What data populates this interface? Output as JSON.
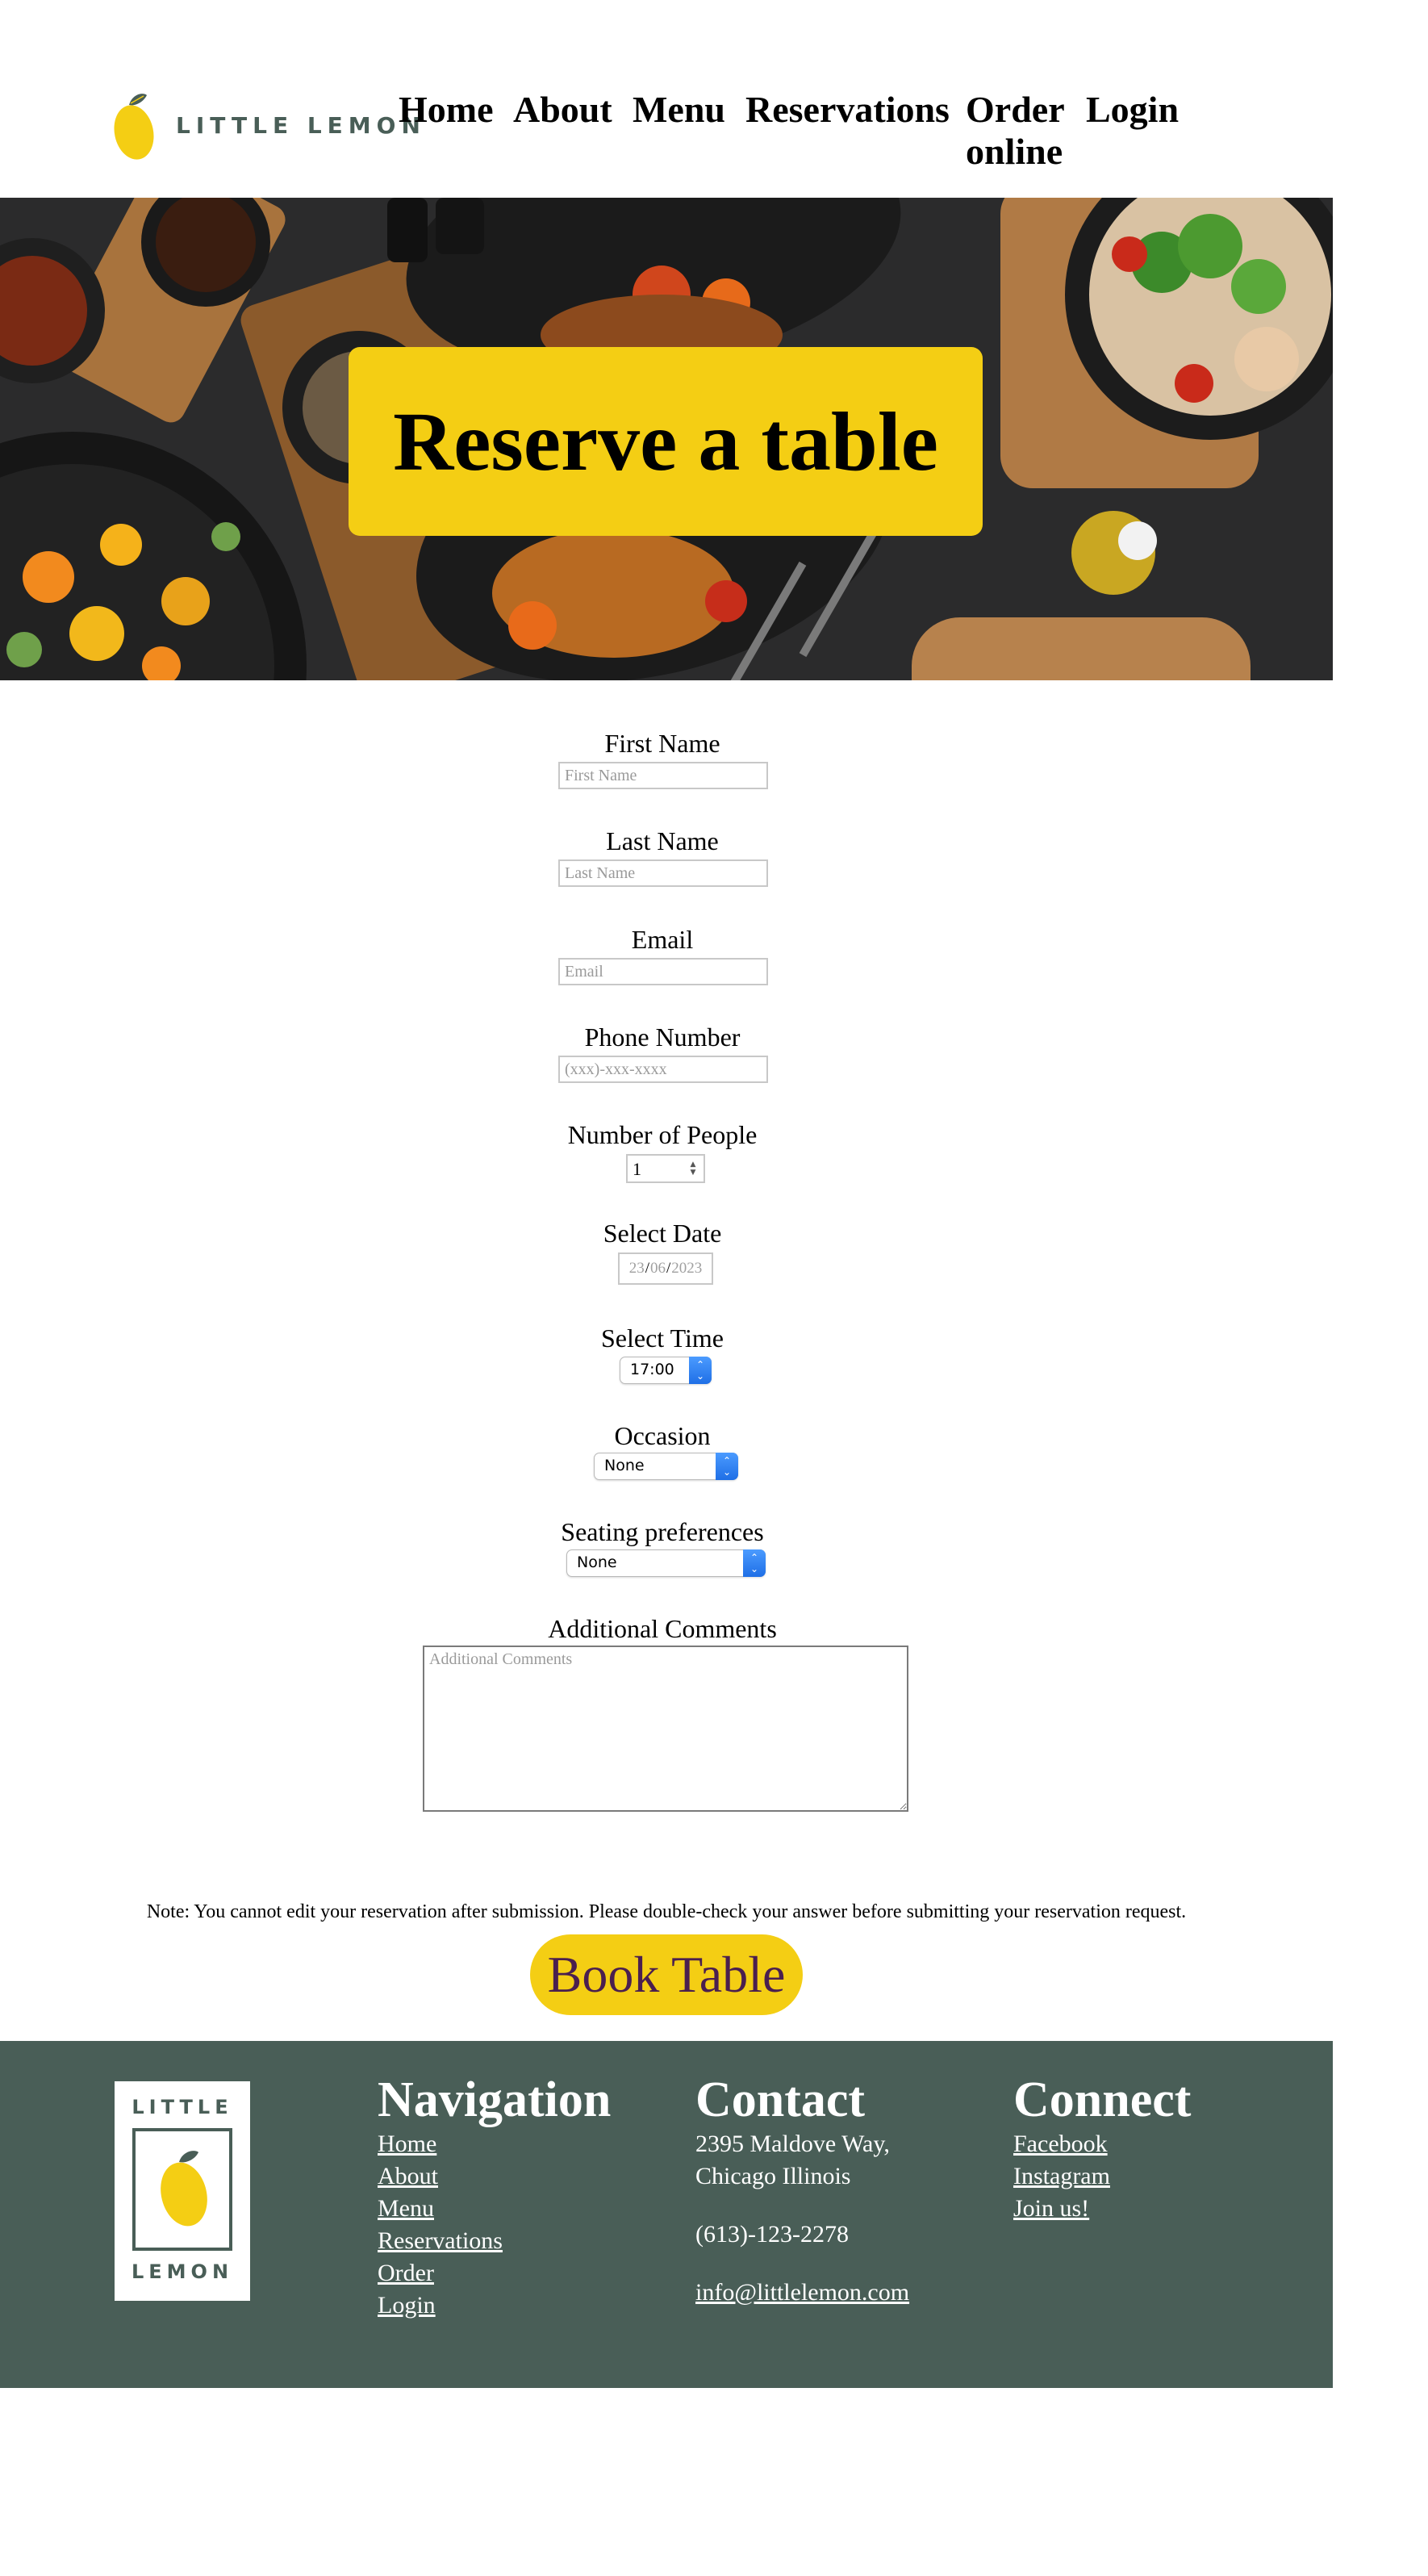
{
  "brand": {
    "logo_text": "LITTLE LEMON",
    "footer_logo_top": "LITTLE",
    "footer_logo_bottom": "LEMON",
    "colors": {
      "green": "#495e57",
      "yellow": "#f4ce14",
      "button_text": "#4a1f4f"
    }
  },
  "nav": {
    "items": [
      {
        "label": "Home"
      },
      {
        "label": "About"
      },
      {
        "label": "Menu"
      },
      {
        "label": "Reservations"
      },
      {
        "label": "Order online"
      },
      {
        "label": "Login"
      }
    ]
  },
  "hero": {
    "title": "Reserve a table"
  },
  "form": {
    "first_name": {
      "label": "First Name",
      "placeholder": "First Name"
    },
    "last_name": {
      "label": "Last Name",
      "placeholder": "Last Name"
    },
    "email": {
      "label": "Email",
      "placeholder": "Email"
    },
    "phone": {
      "label": "Phone Number",
      "placeholder": "(xxx)-xxx-xxxx"
    },
    "people": {
      "label": "Number of People",
      "value": "1"
    },
    "date": {
      "label": "Select Date",
      "day": "23",
      "month": "06",
      "year": "2023",
      "sep": "/"
    },
    "time": {
      "label": "Select Time",
      "value": "17:00"
    },
    "occasion": {
      "label": "Occasion",
      "value": "None"
    },
    "seating": {
      "label": "Seating preferences",
      "value": "None"
    },
    "comments": {
      "label": "Additional Comments",
      "placeholder": "Additional Comments"
    },
    "note": "Note: You cannot edit your reservation after submission. Please double-check your answer before submitting your reservation request.",
    "submit_label": "Book Table"
  },
  "footer": {
    "navigation": {
      "heading": "Navigation",
      "links": [
        "Home",
        "About",
        "Menu",
        "Reservations",
        "Order",
        "Login"
      ]
    },
    "contact": {
      "heading": "Contact",
      "address_line1": "2395 Maldove Way,",
      "address_line2": "Chicago Illinois",
      "phone": "(613)-123-2278",
      "email": "info@littlelemon.com"
    },
    "connect": {
      "heading": "Connect",
      "links": [
        "Facebook",
        "Instagram",
        "Join us!"
      ]
    }
  }
}
